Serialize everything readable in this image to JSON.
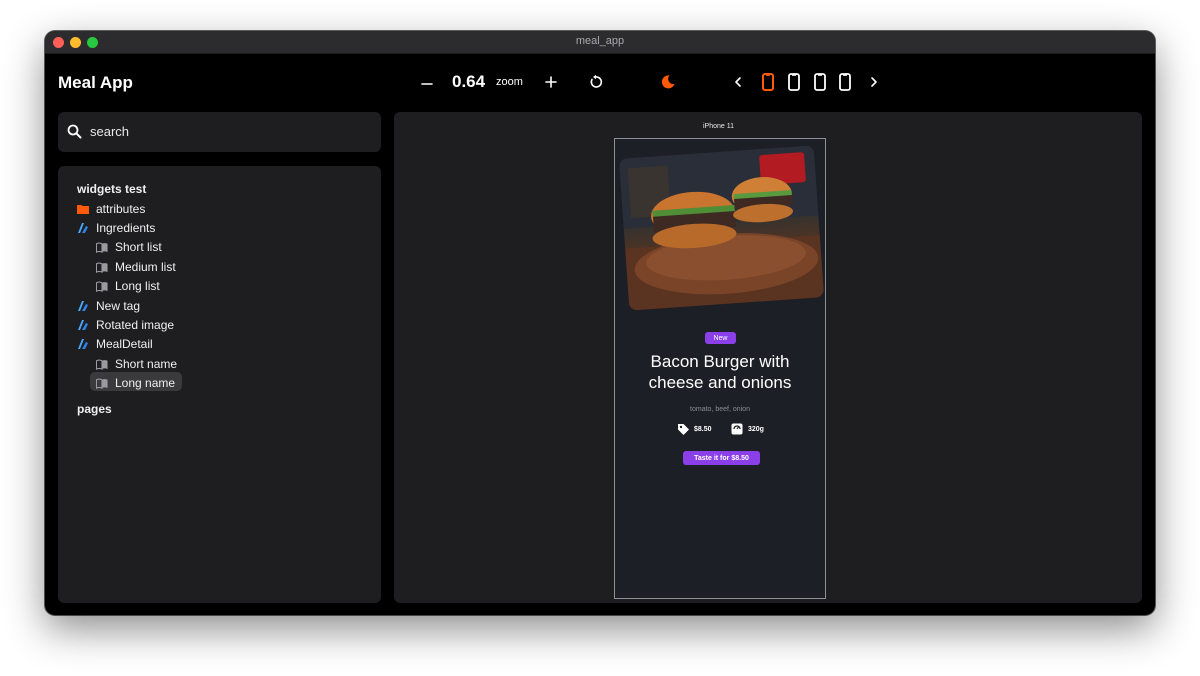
{
  "window": {
    "title": "meal_app"
  },
  "app": {
    "title": "Meal App"
  },
  "toolbar": {
    "zoom_value": "0.64",
    "zoom_label": "zoom",
    "accent_color": "#ff5a0a",
    "icons": [
      "minus-icon",
      "plus-icon",
      "reset-icon",
      "theme-moon-icon",
      "chevron-left-icon",
      "phone-device-icon",
      "phone-device-icon",
      "phone-device-icon",
      "phone-device-icon",
      "chevron-right-icon"
    ]
  },
  "search": {
    "placeholder": "search"
  },
  "tree": {
    "widgets_section": "widgets test",
    "items": [
      {
        "label": "attributes",
        "icon": "folder-icon"
      },
      {
        "label": "Ingredients",
        "icon": "component-icon"
      },
      {
        "label": "Short list",
        "icon": "book-icon"
      },
      {
        "label": "Medium list",
        "icon": "book-icon"
      },
      {
        "label": "Long list",
        "icon": "book-icon"
      },
      {
        "label": "New tag",
        "icon": "component-icon"
      },
      {
        "label": "Rotated image",
        "icon": "component-icon"
      },
      {
        "label": "MealDetail",
        "icon": "component-icon"
      },
      {
        "label": "Short name",
        "icon": "book-icon"
      },
      {
        "label": "Long name",
        "icon": "book-icon",
        "selected": true
      }
    ],
    "pages_section": "pages"
  },
  "preview": {
    "device_name": "iPhone 11",
    "meal": {
      "badge": "New",
      "title_line1": "Bacon Burger with",
      "title_line2": "cheese and onions",
      "ingredients": "tomato, beef, onion",
      "price": "$8.50",
      "weight": "320g",
      "cta": "Taste it for $8.50",
      "accent_color": "#8b3fe8"
    }
  }
}
